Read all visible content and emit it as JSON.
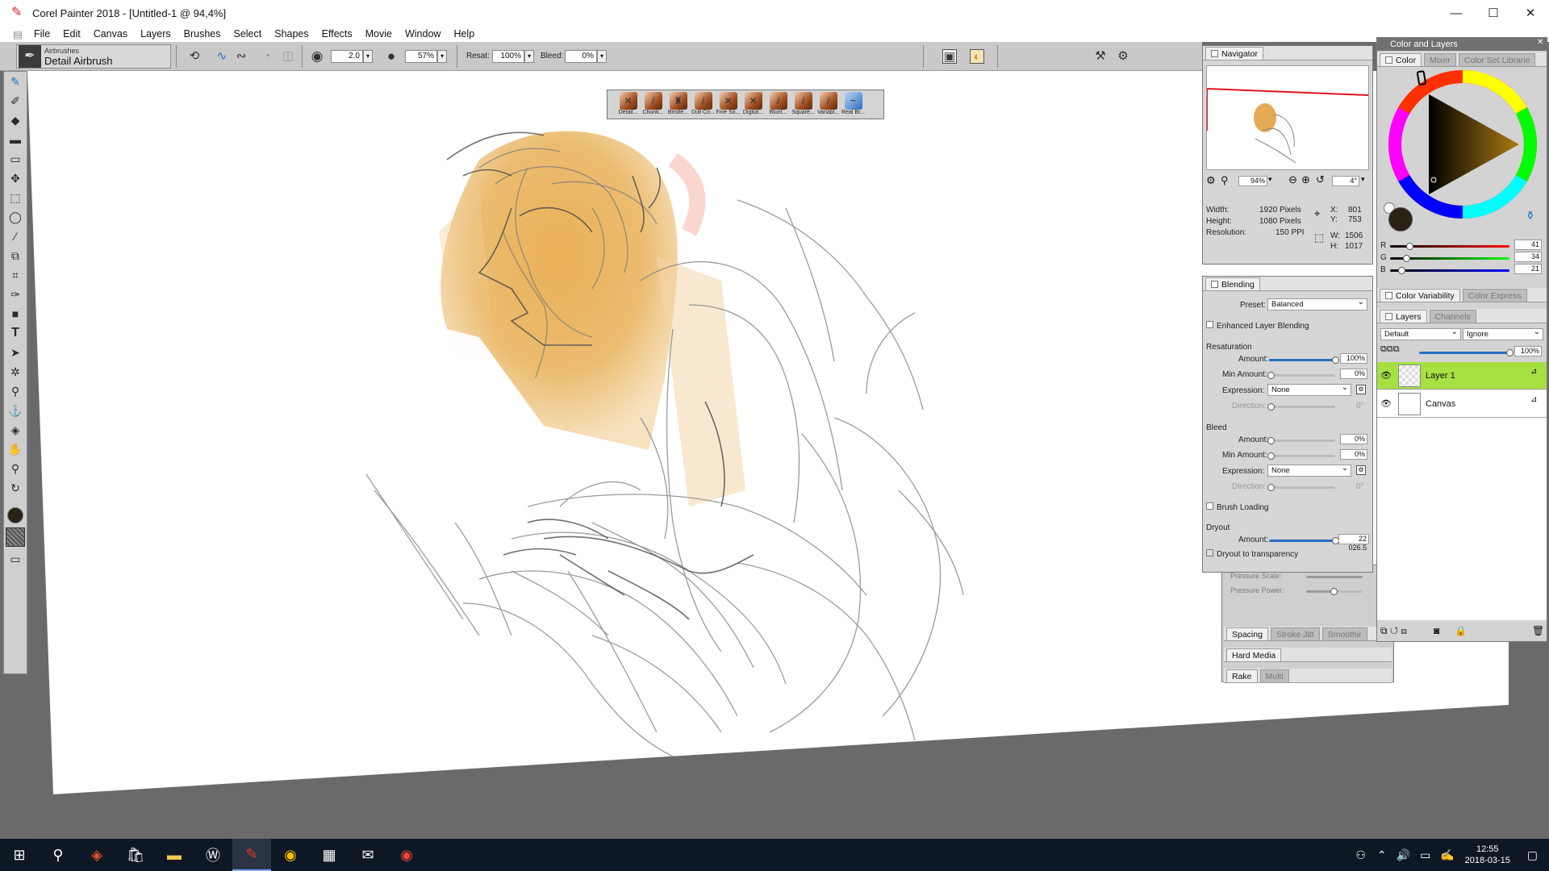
{
  "window": {
    "title": "Corel Painter 2018 - [Untitled-1 @ 94,4%]",
    "minimize": "—",
    "maximize": "☐",
    "close": "✕"
  },
  "menu": [
    "File",
    "Edit",
    "Canvas",
    "Layers",
    "Brushes",
    "Select",
    "Shapes",
    "Effects",
    "Movie",
    "Window",
    "Help"
  ],
  "property_bar": {
    "brush_category": "Airbrushes",
    "brush_variant": "Detail Airbrush",
    "size": "2.0",
    "opacity": "57%",
    "resat_label": "Resat:",
    "resat_value": "100%",
    "bleed_label": "Bleed:",
    "bleed_value": "0%"
  },
  "brush_palette": [
    "Detail...",
    "Chunk...",
    "Bristle...",
    "Dull Co...",
    "Fine So...",
    "Digital...",
    "Blunt...",
    "Square...",
    "Variabl...",
    "Real Br..."
  ],
  "navigator": {
    "title": "Navigator",
    "zoom": "94%",
    "rotation": "4°",
    "width_label": "Width:",
    "width_value": "1920 Pixels",
    "height_label": "Height:",
    "height_value": "1080 Pixels",
    "res_label": "Resolution:",
    "res_value": "150 PPI",
    "x_label": "X:",
    "x_value": "801",
    "y_label": "Y:",
    "y_value": "753",
    "w_label": "W:",
    "w_value": "1506",
    "h_label": "H:",
    "h_value": "1017"
  },
  "blending": {
    "title": "Blending",
    "preset_label": "Preset:",
    "preset_value": "Balanced",
    "enhanced": "Enhanced Layer Blending",
    "resat_section": "Resaturation",
    "amount_label": "Amount:",
    "resat_amount": "100%",
    "resat_amount_pct": 100,
    "min_amount_label": "Min Amount:",
    "resat_min": "0%",
    "expression_label": "Expression:",
    "resat_expression": "None",
    "direction_label": "Direction:",
    "resat_direction": "0°",
    "bleed_section": "Bleed",
    "bleed_amount": "0%",
    "bleed_min": "0%",
    "bleed_expression": "None",
    "bleed_direction": "0°",
    "brush_loading": "Brush Loading",
    "dryout_section": "Dryout",
    "dryout_amount": "22 026.5",
    "dryout_amount_pct": 100,
    "dryout_transparency": "Dryout to transparency"
  },
  "behind_panels": {
    "pressure_scale": "Pressure Scale:",
    "pressure_power": "Pressure Power:",
    "spacing_tabs": [
      "Spacing",
      "Stroke Jitt",
      "Smoothir"
    ],
    "hard_media": "Hard Media",
    "rake_tabs": [
      "Rake",
      "Multi"
    ]
  },
  "color_layers": {
    "title": "Color and Layers",
    "color_tabs": [
      "Color",
      "Mixer",
      "Color Set Librarie"
    ],
    "r_label": "R",
    "r_value": "41",
    "g_label": "G",
    "g_value": "34",
    "b_label": "B",
    "b_value": "21",
    "main_color": "#292215",
    "variability_tabs": [
      "Color Variability",
      "Color Express"
    ],
    "layers_tabs": [
      "Layers",
      "Channels"
    ],
    "composite_method": "Default",
    "composite_depth": "Ignore",
    "opacity": "100%",
    "layers": [
      {
        "name": "Layer 1",
        "selected": true
      },
      {
        "name": "Canvas",
        "selected": false
      }
    ]
  },
  "taskbar": {
    "time": "12:55",
    "date": "2018-03-15"
  }
}
